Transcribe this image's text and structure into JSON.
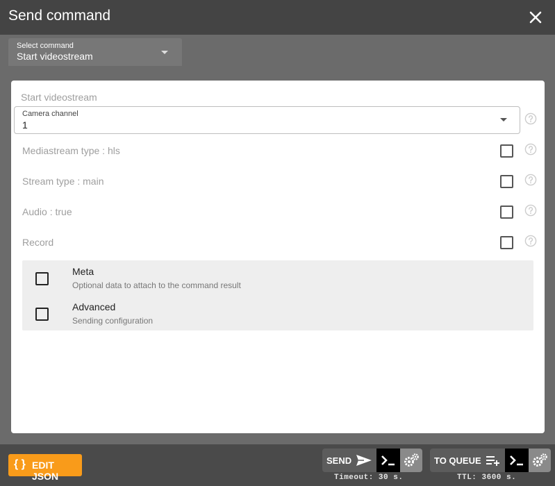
{
  "dialog": {
    "title": "Send command"
  },
  "command_select": {
    "label": "Select command",
    "value": "Start videostream"
  },
  "form": {
    "section_title": "Start videostream",
    "camera_channel": {
      "label": "Camera channel",
      "value": "1"
    },
    "rows": [
      {
        "label": "Mediastream type : hls",
        "checked": false
      },
      {
        "label": "Stream type : main",
        "checked": false
      },
      {
        "label": "Audio : true",
        "checked": false
      },
      {
        "label": "Record",
        "checked": false
      }
    ]
  },
  "options": [
    {
      "title": "Meta",
      "subtitle": "Optional data to attach to the command result"
    },
    {
      "title": "Advanced",
      "subtitle": "Sending configuration"
    }
  ],
  "footer": {
    "edit_json": {
      "icon": "{ }",
      "label": "EDIT JSON"
    },
    "send": {
      "label": "SEND",
      "caption": "Timeout: 30 s."
    },
    "queue": {
      "label": "TO QUEUE",
      "caption": "TTL: 3600 s."
    }
  },
  "colors": {
    "accent": "#f99b1a",
    "header": "#444444",
    "toolbar": "#6b6b6b",
    "terminal": "#000000"
  }
}
